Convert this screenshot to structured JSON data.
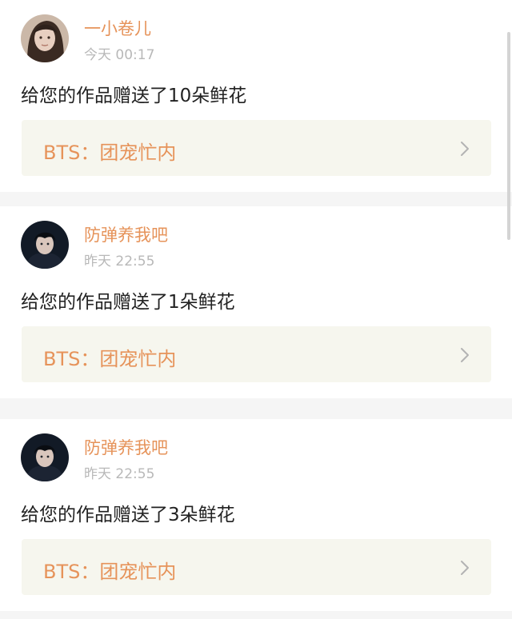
{
  "notifications": [
    {
      "username": "一小卷儿",
      "timestamp": "今天 00:17",
      "message": "给您的作品赠送了10朵鲜花",
      "work_title": "BTS：团宠忙内",
      "avatar": "avatar-photo-girl"
    },
    {
      "username": "防弹养我吧",
      "timestamp": "昨天 22:55",
      "message": "给您的作品赠送了1朵鲜花",
      "work_title": "BTS：团宠忙内",
      "avatar": "avatar-photo-boy"
    },
    {
      "username": "防弹养我吧",
      "timestamp": "昨天 22:55",
      "message": "给您的作品赠送了3朵鲜花",
      "work_title": "BTS：团宠忙内",
      "avatar": "avatar-photo-boy"
    }
  ],
  "icons": {
    "chevron": "chevron-right-icon"
  },
  "colors": {
    "accent": "#e6935a",
    "timestamp": "#b8b8b8",
    "link_bg": "#f6f6ee",
    "divider_bg": "#f5f5f5"
  }
}
